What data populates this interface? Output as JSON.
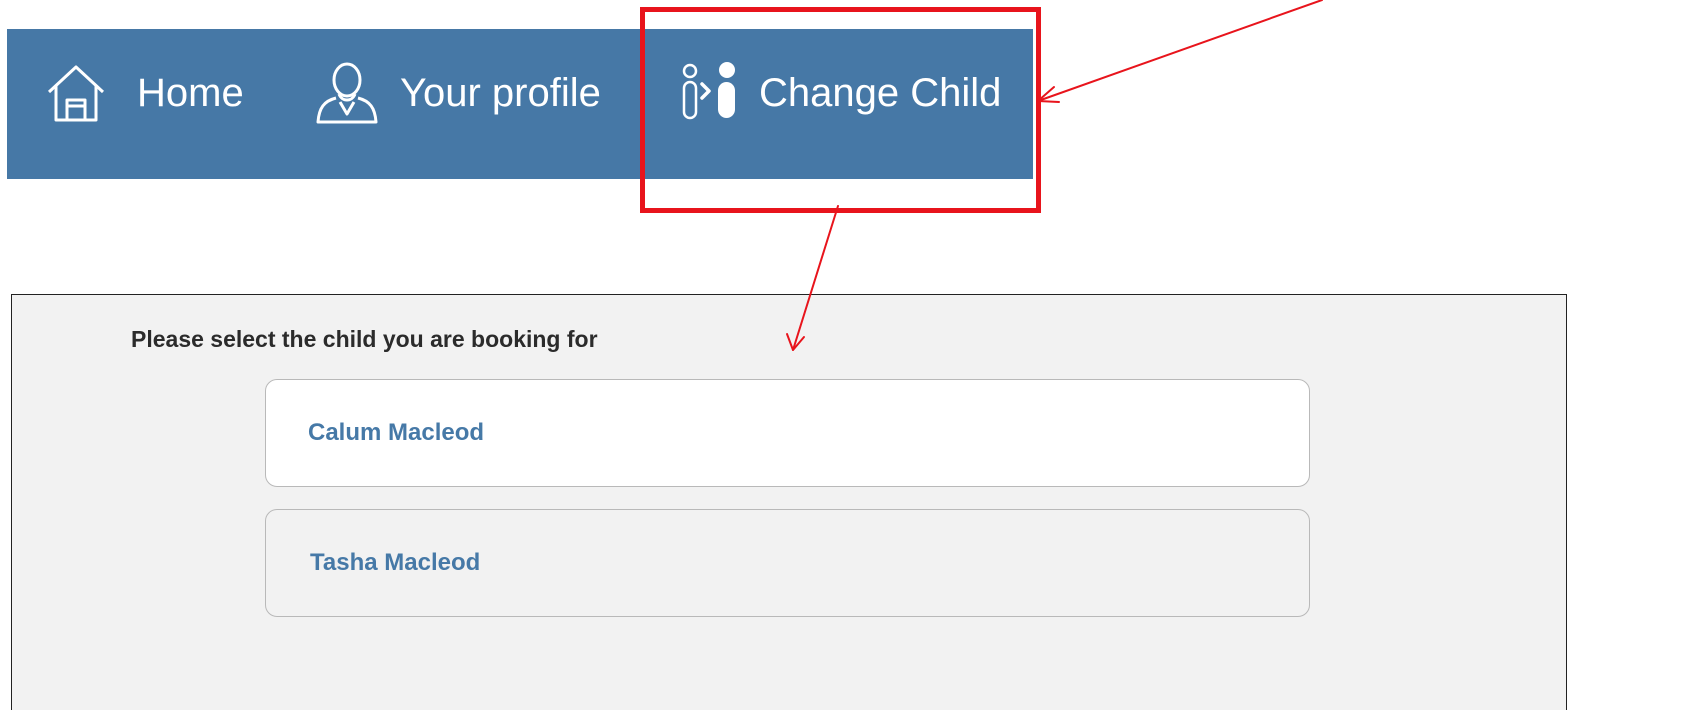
{
  "colors": {
    "nav_bg": "#4678a6",
    "annotation": "#e8141c",
    "panel_bg": "#f2f2f2",
    "link": "#4679a7"
  },
  "nav": {
    "items": [
      {
        "label": "Home",
        "icon": "house-icon"
      },
      {
        "label": "Your profile",
        "icon": "user-profile-icon"
      },
      {
        "label": "Change Child",
        "icon": "change-child-icon"
      }
    ]
  },
  "child_selector": {
    "prompt": "Please select the child you are booking for",
    "children": [
      {
        "name": "Calum Macleod",
        "selected": true
      },
      {
        "name": "Tasha Macleod",
        "selected": false
      }
    ]
  }
}
